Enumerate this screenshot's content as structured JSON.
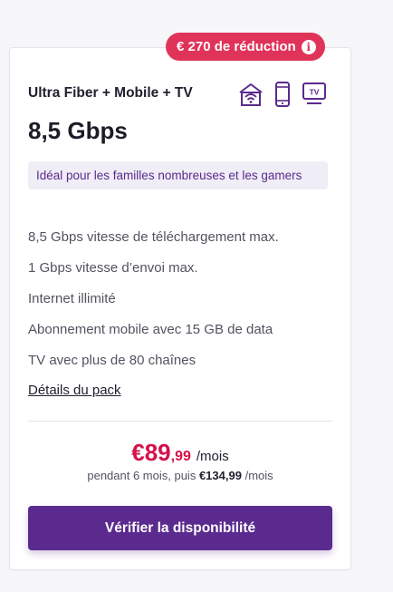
{
  "promo": {
    "label": "€ 270 de réduction",
    "info_icon": "info-icon",
    "info_glyph": "i",
    "color": "#e0335a"
  },
  "plan": {
    "title": "Ultra Fiber + Mobile + TV",
    "icons": [
      "wifi-router-icon",
      "mobile-phone-icon",
      "tv-icon"
    ],
    "tv_icon_text": "TV",
    "speed": "8,5 Gbps",
    "tagline": "Idéal pour les familles nombreuses et les gamers"
  },
  "features": [
    "8,5 Gbps vitesse de téléchargement max.",
    "1 Gbps vitesse d’envoi max.",
    "Internet illimité",
    "Abonnement mobile avec 15 GB de data",
    "TV avec plus de 80 chaînes"
  ],
  "details_link": "Détails du pack",
  "price": {
    "main": "€89",
    "cents": ",99",
    "unit": "/mois",
    "sub_prefix": "pendant 6 mois, puis",
    "sub_price": "€134,99",
    "sub_unit": "/mois",
    "color": "#d3124b"
  },
  "cta": {
    "label": "Vérifier la disponibilité",
    "color": "#5b2a8e"
  }
}
